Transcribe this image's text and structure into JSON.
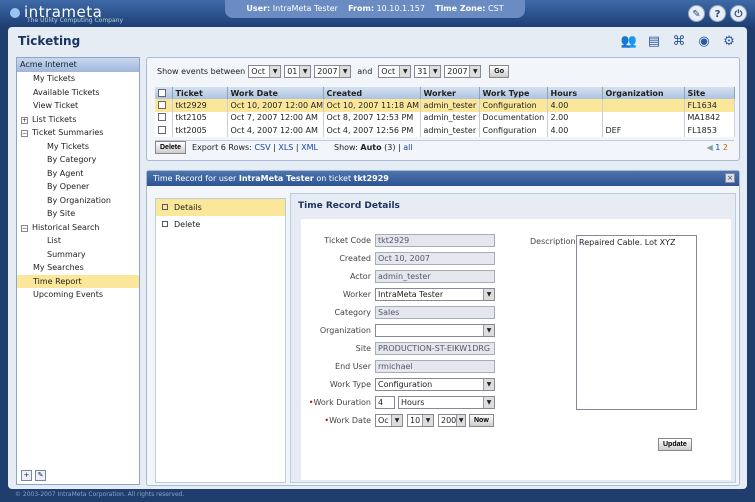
{
  "header": {
    "logo_text": "intrameta",
    "tagline": "The Utility Computing Company",
    "user_label": "User:",
    "user_value": "IntraMeta Tester",
    "from_label": "From:",
    "from_value": "10.10.1.157",
    "tz_label": "Time Zone:",
    "tz_value": "CST"
  },
  "app": {
    "title": "Ticketing"
  },
  "sidebar": {
    "header": "Acme Internet",
    "items": [
      {
        "label": "My Tickets",
        "indent": 1
      },
      {
        "label": "Available Tickets",
        "indent": 1
      },
      {
        "label": "View Ticket",
        "indent": 1
      },
      {
        "label": "List Tickets",
        "indent": 0,
        "expand": "+"
      },
      {
        "label": "Ticket Summaries",
        "indent": 0,
        "expand": "−"
      },
      {
        "label": "My Tickets",
        "indent": 2
      },
      {
        "label": "By Category",
        "indent": 2
      },
      {
        "label": "By Agent",
        "indent": 2
      },
      {
        "label": "By Opener",
        "indent": 2
      },
      {
        "label": "By Organization",
        "indent": 2
      },
      {
        "label": "By Site",
        "indent": 2
      },
      {
        "label": "Historical Search",
        "indent": 0,
        "expand": "−"
      },
      {
        "label": "List",
        "indent": 2
      },
      {
        "label": "Summary",
        "indent": 2
      },
      {
        "label": "My Searches",
        "indent": 1
      },
      {
        "label": "Time Report",
        "indent": 1,
        "selected": true
      },
      {
        "label": "Upcoming Events",
        "indent": 1
      }
    ]
  },
  "filter": {
    "label": "Show events between",
    "from_month": "Oct",
    "from_day": "01",
    "from_year": "2007",
    "and_label": "and",
    "to_month": "Oct",
    "to_day": "31",
    "to_year": "2007",
    "go_label": "Go"
  },
  "grid": {
    "columns": [
      "Ticket",
      "Work Date",
      "Created",
      "Worker",
      "Work Type",
      "Hours",
      "Organization",
      "Site"
    ],
    "rows": [
      [
        "tkt2929",
        "Oct 10, 2007 12:00 AM",
        "Oct 10, 2007 11:18 AM",
        "admin_tester",
        "Configuration",
        "4.00",
        "",
        "FL1634"
      ],
      [
        "tkt2105",
        "Oct 7, 2007 12:00 AM",
        "Oct 8, 2007 12:53 PM",
        "admin_tester",
        "Documentation",
        "2.00",
        "",
        "MA1842"
      ],
      [
        "tkt2005",
        "Oct 4, 2007 12:00 AM",
        "Oct 4, 2007 12:56 PM",
        "admin_tester",
        "Configuration",
        "4.00",
        "DEF",
        "FL1853"
      ]
    ],
    "delete_label": "Delete",
    "export_label": "Export 6 Rows:",
    "csv": "CSV",
    "xls": "XLS",
    "xml": "XML",
    "show_label": "Show:",
    "show_auto": "Auto",
    "show_count": "(3)",
    "show_all": "all",
    "page1": "1",
    "page2": "2"
  },
  "record": {
    "title_prefix": "Time Record for user",
    "title_user": "IntraMeta Tester",
    "title_mid": "on ticket",
    "title_ticket": "tkt2929",
    "tabs": [
      "Details",
      "Delete"
    ],
    "section_title": "Time Record Details",
    "fields": {
      "ticket_code": {
        "label": "Ticket Code",
        "value": "tkt2929"
      },
      "created": {
        "label": "Created",
        "value": "Oct 10, 2007"
      },
      "actor": {
        "label": "Actor",
        "value": "admin_tester"
      },
      "worker": {
        "label": "Worker",
        "value": "IntraMeta Tester"
      },
      "category": {
        "label": "Category",
        "value": "Sales"
      },
      "organization": {
        "label": "Organization",
        "value": ""
      },
      "site": {
        "label": "Site",
        "value": "PRODUCTION-ST-EIKW1DRG"
      },
      "end_user": {
        "label": "End User",
        "value": "rmichael"
      },
      "work_type": {
        "label": "Work Type",
        "value": "Configuration"
      },
      "work_duration": {
        "label": "Work Duration",
        "value": "4",
        "unit": "Hours"
      },
      "work_date": {
        "label": "Work Date",
        "month": "Oc",
        "day": "10",
        "year": "200",
        "now_label": "Now"
      }
    },
    "description_label": "Description",
    "description": "Repaired Cable.  Lot XYZ",
    "update_label": "Update"
  },
  "footer": {
    "copyright": "© 2003-2007 IntraMeta Corporation.  All rights reserved."
  }
}
